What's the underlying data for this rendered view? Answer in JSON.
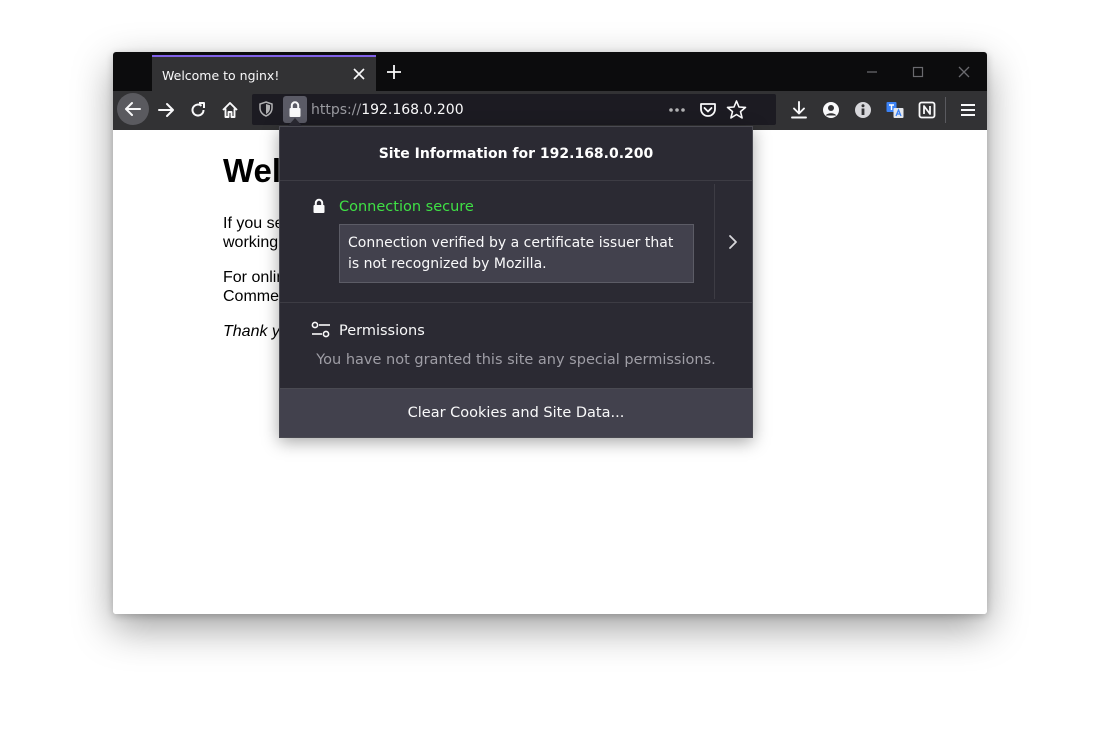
{
  "tab": {
    "title": "Welcome to nginx!",
    "close_icon": "close-icon",
    "new_tab_icon": "plus-icon"
  },
  "window_controls": [
    "minimize-icon",
    "maximize-icon",
    "close-icon"
  ],
  "urlbar": {
    "scheme": "https://",
    "host": "192.168.0.200"
  },
  "page": {
    "heading": "Wel",
    "para1_line1": "If you se",
    "para1_line2": "working",
    "para2_line1": "For onlin",
    "para2_line2": "Commer",
    "para3": "Thank y"
  },
  "site_info": {
    "title": "Site Information for 192.168.0.200",
    "connection_status": "Connection secure",
    "connection_detail": "Connection verified by a certificate issuer that is not recognized by Mozilla.",
    "permissions_label": "Permissions",
    "permissions_note": "You have not granted this site any special permissions.",
    "clear_button": "Clear Cookies and Site Data..."
  },
  "colors": {
    "accent": "#8060e8",
    "secure_green": "#3fe045",
    "panel_bg": "#2b2a33",
    "toolbar_bg": "#323234"
  }
}
